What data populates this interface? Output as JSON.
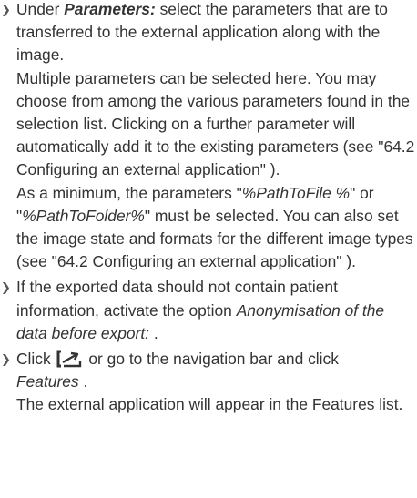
{
  "steps": [
    {
      "intro": "Under ",
      "keyword": "Parameters:",
      "text": " select the parameters that are to transferred to the external application along with the image.",
      "para2": "Multiple parameters can be selected here. You may choose from among the various parame­ters found in the selection list. Clicking on a fur­ther parameter will automatically add it to the existing parameters (see \"64.2 Configuring an external application\" ).",
      "para3_a": "As a minimum, the parameters \"",
      "param1": "%PathToFile %",
      "para3_b": "\" or \"",
      "param2": "%PathToFolder%",
      "para3_c": "\" must be selected. You can also set the image state and formats for the different image types (see \"64.2 Configu­ring an external application\" )."
    },
    {
      "text": "If the exported data should not contain patient information, activate the option ",
      "option": "Anonymisation of the data before export:",
      "tail": " ."
    },
    {
      "click_label": "Click",
      "or_text": " or go to the navigation bar and click",
      "features": "Features",
      "features_tail": " .",
      "result": "The external application will appear in the Fea­tures list."
    }
  ],
  "icons": {
    "bullet": "chevron-right-icon",
    "export": "export-arrow-icon"
  }
}
